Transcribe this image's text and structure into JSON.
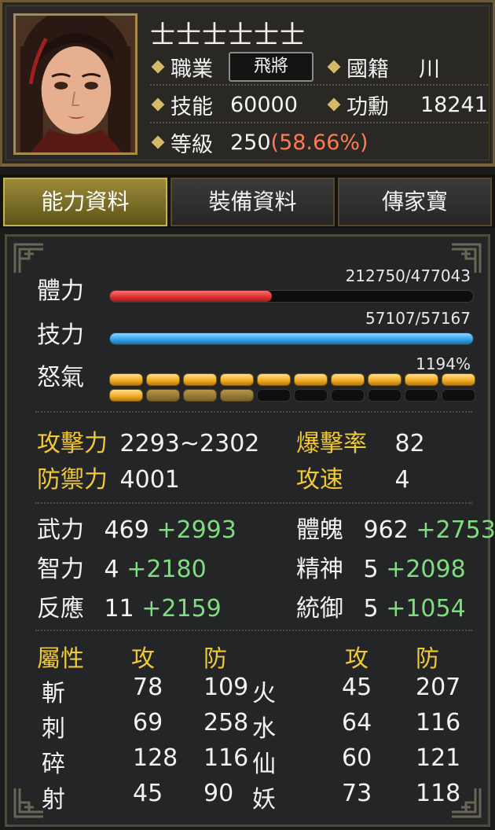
{
  "hero": {
    "name": "士士士士士士",
    "job_label": "職業",
    "job_value": "飛將",
    "nation_label": "國籍",
    "nation_value": "川",
    "skill_label": "技能",
    "skill_value": "60000",
    "merit_label": "功勳",
    "merit_value": "18241",
    "level_label": "等級",
    "level_value": "250",
    "level_pct": "(58.66%)"
  },
  "tabs": [
    {
      "label": "能力資料",
      "active": true
    },
    {
      "label": "裝備資料",
      "active": false
    },
    {
      "label": "傳家寶",
      "active": false
    }
  ],
  "bars": {
    "hp": {
      "label": "體力",
      "text": "212750/477043",
      "current": 212750,
      "max": 477043
    },
    "mp": {
      "label": "技力",
      "text": "57107/57167",
      "current": 57107,
      "max": 57167
    },
    "rage": {
      "label": "怒氣",
      "text": "1194%",
      "row1_full": 10,
      "row2_half": 4,
      "row2_full_first": 1
    }
  },
  "combat": {
    "atk_label": "攻擊力",
    "atk_value": "2293~2302",
    "crit_label": "爆擊率",
    "crit_value": "82",
    "def_label": "防禦力",
    "def_value": "4001",
    "spd_label": "攻速",
    "spd_value": "4"
  },
  "stats": {
    "str_label": "武力",
    "str_value": "469",
    "str_bonus": "+2993",
    "con_label": "體魄",
    "con_value": "962",
    "con_bonus": "+2753",
    "int_label": "智力",
    "int_value": "4",
    "int_bonus": "+2180",
    "spi_label": "精神",
    "spi_value": "5",
    "spi_bonus": "+2098",
    "ref_label": "反應",
    "ref_value": "11",
    "ref_bonus": "+2159",
    "cmd_label": "統御",
    "cmd_value": "5",
    "cmd_bonus": "+1054"
  },
  "attributes": {
    "header": {
      "attr": "屬性",
      "atk": "攻",
      "def": "防",
      "atk2": "攻",
      "def2": "防"
    },
    "rows": [
      {
        "name": "斬",
        "atk": "78",
        "def": "109",
        "name2": "火",
        "atk2": "45",
        "def2": "207"
      },
      {
        "name": "刺",
        "atk": "69",
        "def": "258",
        "name2": "水",
        "atk2": "64",
        "def2": "116"
      },
      {
        "name": "碎",
        "atk": "128",
        "def": "116",
        "name2": "仙",
        "atk2": "60",
        "def2": "121"
      },
      {
        "name": "射",
        "atk": "45",
        "def": "90",
        "name2": "妖",
        "atk2": "73",
        "def2": "118"
      }
    ]
  },
  "colors": {
    "gold_label": "#f0c838",
    "bonus_green": "#7fdc7f",
    "level_pct": "#ff7a52",
    "hp_bar": "#d82e2e",
    "mp_bar": "#2e9ee6"
  }
}
